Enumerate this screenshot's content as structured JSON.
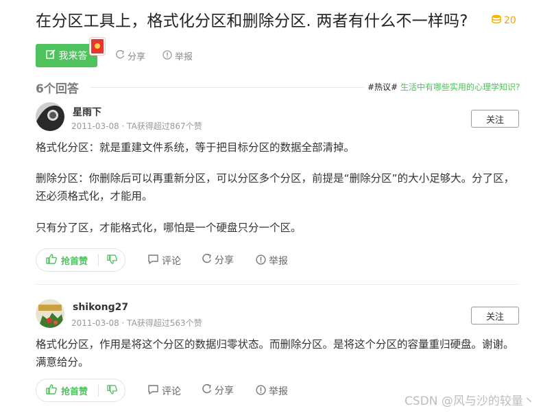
{
  "question": {
    "title": "在分区工具上，格式化分区和删除分区. 两者有什么不一样吗?",
    "bounty": "20"
  },
  "toolbar": {
    "answer_label": "我来答",
    "share_label": "分享",
    "report_label": "举报"
  },
  "answers_header": {
    "count_label": "6个回答",
    "hot_prefix": "#热议#",
    "hot_topic": " 生活中有哪些实用的心理学知识?"
  },
  "answers": [
    {
      "user": "星雨下",
      "meta": "2011-03-08 · TA获得超过867个赞",
      "follow_label": "关注",
      "paragraphs": [
        "格式化分区：就是重建文件系统，等于把目标分区的数据全部清掉。",
        "删除分区：你删除后可以再重新分区，可以分区多个分区，前提是“删除分区”的大小足够大。分了区，还必须格式化，才能用。",
        "只有分了区，才能格式化，哪怕是一个硬盘只分一个区。"
      ],
      "upvote_label": "抢首赞",
      "comment_label": "评论",
      "share_label": "分享",
      "report_label": "举报"
    },
    {
      "user": "shikong27",
      "meta": "2011-03-08 · TA获得超过563个赞",
      "follow_label": "关注",
      "paragraphs": [
        "格式化分区，作用是将这个分区的数据归零状态。而删除分区。是将这个分区的容量重归硬盘。谢谢。满意给分。"
      ],
      "upvote_label": "抢首赞",
      "comment_label": "评论",
      "share_label": "分享",
      "report_label": "举报"
    }
  ],
  "watermark": "CSDN @风与沙的较量丶",
  "colors": {
    "accent": "#4fc25d",
    "bounty": "#f0a400",
    "redpack": "#e8352e"
  },
  "icons": [
    "coin-icon",
    "edit-icon",
    "share-icon",
    "report-icon",
    "thumb-up-icon",
    "thumb-down-icon",
    "comment-icon",
    "red-packet-icon"
  ]
}
